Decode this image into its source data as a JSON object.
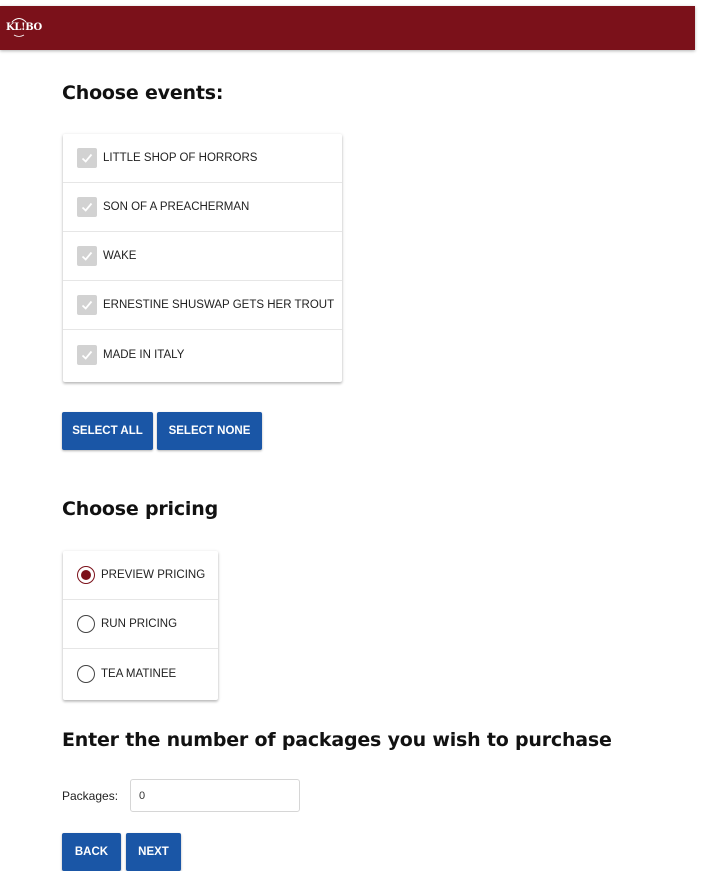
{
  "header": {
    "logo_text": "KL!BO",
    "background_color": "#7b111a"
  },
  "events": {
    "title": "Choose events:",
    "items": [
      {
        "label": "LITTLE SHOP OF HORRORS",
        "checked": true
      },
      {
        "label": "SON OF A PREACHERMAN",
        "checked": true
      },
      {
        "label": "WAKE",
        "checked": true
      },
      {
        "label": "ERNESTINE SHUSWAP GETS HER TROUT",
        "checked": true
      },
      {
        "label": "MADE IN ITALY",
        "checked": true
      }
    ],
    "select_all_label": "SELECT ALL",
    "select_none_label": "SELECT NONE"
  },
  "pricing": {
    "title": "Choose pricing",
    "options": [
      {
        "label": "PREVIEW PRICING",
        "selected": true
      },
      {
        "label": "RUN PRICING",
        "selected": false
      },
      {
        "label": "TEA MATINEE",
        "selected": false
      }
    ]
  },
  "packages": {
    "title": "Enter the number of packages you wish to purchase",
    "label": "Packages:",
    "value": "0"
  },
  "nav": {
    "back_label": "BACK",
    "next_label": "NEXT"
  },
  "colors": {
    "accent": "#7b111a",
    "button": "#1a56a6",
    "checkbox_checked": "#d2d2d2"
  }
}
